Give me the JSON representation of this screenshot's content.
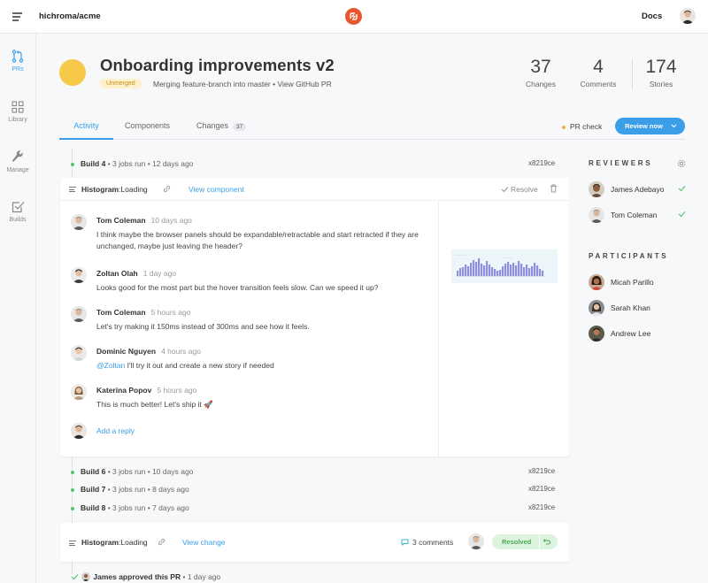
{
  "topbar": {
    "repo": "hichroma/acme",
    "docs_label": "Docs"
  },
  "sidebar": {
    "items": [
      {
        "label": "PRs",
        "icon": "pull-request-icon",
        "active": true
      },
      {
        "label": "Library",
        "icon": "grid-icon",
        "active": false
      },
      {
        "label": "Manage",
        "icon": "wrench-icon",
        "active": false
      },
      {
        "label": "Builds",
        "icon": "checkbox-icon",
        "active": false
      }
    ]
  },
  "pr": {
    "title": "Onboarding improvements v2",
    "badge": "Unmerged",
    "subtitle": "Merging feature-branch into master • View GitHub PR",
    "stats": [
      {
        "num": "37",
        "label": "Changes"
      },
      {
        "num": "4",
        "label": "Comments"
      },
      {
        "num": "174",
        "label": "Stories"
      }
    ]
  },
  "tabs": [
    {
      "label": "Activity",
      "active": true
    },
    {
      "label": "Components",
      "active": false
    },
    {
      "label": "Changes",
      "count": "37",
      "active": false
    }
  ],
  "pr_check_label": "PR check",
  "review_button": "Review now",
  "timeline": {
    "build4": {
      "name": "Build 4",
      "meta": "• 3 jobs run • 12 days ago",
      "hash": "x8219ce"
    },
    "builds": [
      {
        "name": "Build 6",
        "meta": "• 3 jobs run • 10 days ago",
        "hash": "x8219ce"
      },
      {
        "name": "Build 7",
        "meta": "• 3 jobs run • 8 days ago",
        "hash": "x8219ce"
      },
      {
        "name": "Build 8",
        "meta": "• 3 jobs run • 7 days ago",
        "hash": "x8219ce"
      }
    ],
    "approved": {
      "name": "James approved this PR",
      "meta": "• 1 day ago"
    }
  },
  "card": {
    "component": "Histogram",
    "state": ":Loading",
    "view_component": "View component",
    "resolve": "Resolve",
    "comments": [
      {
        "author": "Tom Coleman",
        "time": "10 days ago",
        "body": "I think maybe the browser panels should be expandable/retractable and start retracted if they are unchanged, maybe just leaving the header?"
      },
      {
        "author": "Zoltan Olah",
        "time": "1 day ago",
        "body": "Looks good for the most part but the hover transition feels slow. Can we speed it up?"
      },
      {
        "author": "Tom Coleman",
        "time": "5 hours ago",
        "body": "Let's try making it 150ms instead of 300ms and see how it feels."
      },
      {
        "author": "Dominic Nguyen",
        "time": "4 hours ago",
        "mention": "@Zoltan",
        "body": "I'll try it out and create a new story if needed"
      },
      {
        "author": "Katerina Popov",
        "time": "5 hours ago",
        "body": "This is much better! Let's ship it 🚀"
      }
    ],
    "add_reply": "Add a reply"
  },
  "card2": {
    "component": "Histogram",
    "state": ":Loading",
    "view_change": "View change",
    "comments_count": "3 comments",
    "resolved": "Resolved"
  },
  "reviewers": {
    "title": "REVIEWERS",
    "people": [
      {
        "name": "James Adebayo",
        "approved": true
      },
      {
        "name": "Tom Coleman",
        "approved": true
      }
    ]
  },
  "participants": {
    "title": "PARTICIPANTS",
    "people": [
      {
        "name": "Micah Parillo"
      },
      {
        "name": "Sarah Khan"
      },
      {
        "name": "Andrew Lee"
      }
    ]
  },
  "colors": {
    "accent": "#3a9ee8",
    "pr_dot": "#f7c948",
    "logo": "#e8562f",
    "success": "#5cc26e"
  }
}
